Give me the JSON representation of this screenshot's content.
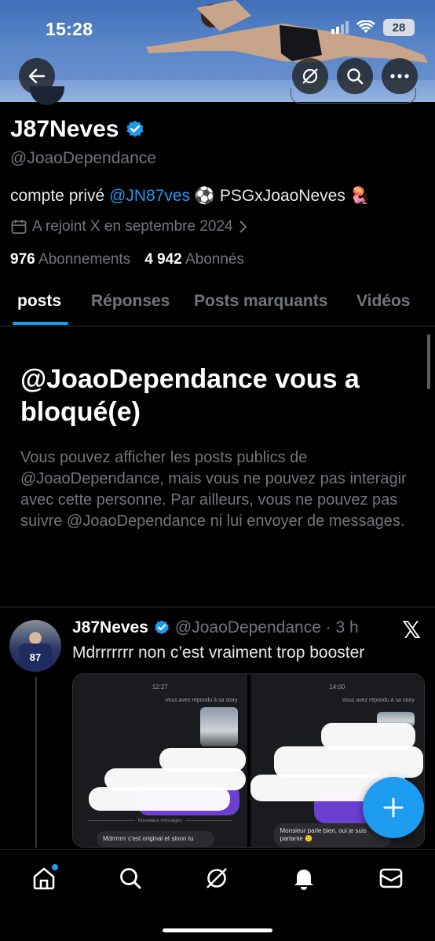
{
  "status_bar": {
    "time": "15:28",
    "battery": "28"
  },
  "profile": {
    "display_name": "J87Neves",
    "handle": "@JoaoDependance",
    "bio_prefix": "compte privé ",
    "bio_mention": "@JN87ves",
    "bio_suffix": " ⚽ PSGxJoaoNeves 🪼",
    "joined": "A rejoint X en septembre 2024",
    "following_count": "976",
    "following_label": "Abonnements",
    "followers_count": "4 942",
    "followers_label": "Abonnés"
  },
  "tabs": [
    "posts",
    "Réponses",
    "Posts marquants",
    "Vidéos"
  ],
  "blocked": {
    "title": "@JoaoDependance vous a bloqué(e)",
    "text": "Vous pouvez afficher les posts publics de @JoaoDependance, mais vous ne pouvez pas interagir avec cette personne. Par ailleurs, vous ne pouvez pas suivre @JoaoDependance ni lui envoyer de messages."
  },
  "post": {
    "name": "J87Neves",
    "handle_time": "@JoaoDependance · 3 h",
    "text": "Mdrrrrrrr non c’est vraiment trop booster",
    "avatar_jersey": "87",
    "shots": [
      {
        "time": "12:27",
        "replied": "Vous avez répondu à sa story",
        "divider": "Nouveaux messages",
        "message": "Mdrrrrrrr c'est original et sinon tu"
      },
      {
        "time": "14:00",
        "replied": "Vous avez répondu à sa story",
        "message": "Monsieur parle bien, oui je suis partante 🙂"
      }
    ]
  },
  "colors": {
    "accent": "#1d9bf0",
    "background": "#000000",
    "muted": "#71767b"
  },
  "icons": [
    "back-arrow-icon",
    "grok-icon",
    "search-icon",
    "more-icon",
    "verified-badge-icon",
    "calendar-icon",
    "chevron-right-icon",
    "x-logo-icon",
    "plus-icon",
    "home-icon",
    "bell-icon",
    "mail-icon"
  ]
}
